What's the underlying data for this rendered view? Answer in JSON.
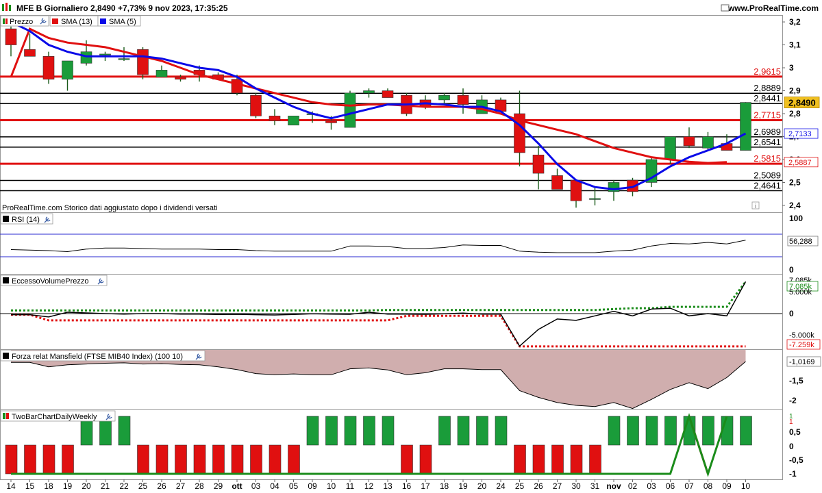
{
  "header": {
    "title": "MFE B Giornaliero 2,8490 +7,73% 9 nov 2023, 17:35:25",
    "site": "www.ProRealTime.com",
    "icon_left": "green-red-bars-icon",
    "icon_right": "window-icon"
  },
  "price_panel": {
    "legend": [
      {
        "label": "Prezzo",
        "color": "#1a8c1a",
        "icon": "candles-icon"
      },
      {
        "label": "SMA (13)",
        "color": "#e01010",
        "icon": "line-icon"
      },
      {
        "label": "SMA (5)",
        "color": "#0a0ae8",
        "icon": "line-icon"
      }
    ],
    "note": "ProRealTime.com  Storico dati aggiustato dopo i dividendi versati",
    "info_icon": "i",
    "y_ticks": [
      "3,2",
      "3,1",
      "3",
      "2,9",
      "2,8",
      "2,7",
      "2,6",
      "2,5",
      "2,4"
    ],
    "y_tick_values": [
      3.2,
      3.1,
      3.0,
      2.9,
      2.8,
      2.7,
      2.6,
      2.5,
      2.4
    ],
    "ylim": [
      2.37,
      3.23
    ],
    "last_price_tag": "2,8490",
    "sma5_tag": "2,7133",
    "sma13_tag": "2,5887",
    "levels": [
      {
        "label": "2,9615",
        "value": 2.9615,
        "color": "#e01010"
      },
      {
        "label": "2,8889",
        "value": 2.8889,
        "color": "#000000"
      },
      {
        "label": "2,8441",
        "value": 2.8441,
        "color": "#000000"
      },
      {
        "label": "2,7715",
        "value": 2.7715,
        "color": "#e01010"
      },
      {
        "label": "2,6989",
        "value": 2.6989,
        "color": "#000000"
      },
      {
        "label": "2,6541",
        "value": 2.6541,
        "color": "#000000"
      },
      {
        "label": "2,5815",
        "value": 2.5815,
        "color": "#e01010"
      },
      {
        "label": "2,5089",
        "value": 2.5089,
        "color": "#000000"
      },
      {
        "label": "2,4641",
        "value": 2.4641,
        "color": "#000000"
      }
    ]
  },
  "rsi_panel": {
    "title": "RSI (14)",
    "y_ticks": [
      "100",
      "0"
    ],
    "value_tag": "56,288"
  },
  "evp_panel": {
    "title": "EccessoVolumePrezzo",
    "y_ticks": [
      "5.000k",
      "0",
      "-5.000k"
    ],
    "top_tag_hidden": "7.085k",
    "tag_green": "7.085k",
    "tag_red": "-7.259k",
    "zero_label": "0"
  },
  "mansfield_panel": {
    "title": "Forza relat Mansfield (FTSE MIB40 Index) (100 10)",
    "y_ticks": [
      "-1,5",
      "-2"
    ],
    "value_tag": "-1,0169"
  },
  "twobar_panel": {
    "title": "TwoBarChartDailyWeekly",
    "y_ticks": [
      "0,5",
      "0",
      "-0,5",
      "-1"
    ],
    "top_tags": [
      "1",
      "1"
    ]
  },
  "x_axis": {
    "labels": [
      "14",
      "15",
      "18",
      "19",
      "20",
      "21",
      "22",
      "25",
      "26",
      "27",
      "28",
      "29",
      "ott",
      "03",
      "04",
      "05",
      "09",
      "10",
      "11",
      "12",
      "13",
      "16",
      "17",
      "18",
      "19",
      "20",
      "24",
      "25",
      "26",
      "27",
      "30",
      "31",
      "nov",
      "02",
      "03",
      "06",
      "07",
      "08",
      "09",
      "10"
    ]
  },
  "chart_data": {
    "type": "candlestick",
    "dates": [
      "14",
      "15",
      "18",
      "19",
      "20",
      "21",
      "22",
      "25",
      "26",
      "27",
      "28",
      "29",
      "ott",
      "03",
      "04",
      "05",
      "09",
      "10",
      "11",
      "12",
      "13",
      "16",
      "17",
      "18",
      "19",
      "20",
      "24",
      "25",
      "26",
      "27",
      "30",
      "31",
      "nov",
      "02",
      "03",
      "06",
      "07",
      "08",
      "09"
    ],
    "candles": [
      {
        "o": 3.17,
        "h": 3.18,
        "l": 3.05,
        "c": 3.1
      },
      {
        "o": 3.08,
        "h": 3.15,
        "l": 3.05,
        "c": 3.05
      },
      {
        "o": 3.05,
        "h": 3.07,
        "l": 2.93,
        "c": 2.95
      },
      {
        "o": 2.95,
        "h": 3.03,
        "l": 2.9,
        "c": 3.03
      },
      {
        "o": 3.02,
        "h": 3.12,
        "l": 3.01,
        "c": 3.07
      },
      {
        "o": 3.06,
        "h": 3.07,
        "l": 3.03,
        "c": 3.06
      },
      {
        "o": 3.04,
        "h": 3.09,
        "l": 3.03,
        "c": 3.04
      },
      {
        "o": 3.08,
        "h": 3.09,
        "l": 2.95,
        "c": 2.97
      },
      {
        "o": 2.96,
        "h": 3.01,
        "l": 2.96,
        "c": 2.99
      },
      {
        "o": 2.96,
        "h": 2.97,
        "l": 2.94,
        "c": 2.95
      },
      {
        "o": 2.99,
        "h": 3.01,
        "l": 2.94,
        "c": 2.97
      },
      {
        "o": 2.97,
        "h": 2.98,
        "l": 2.95,
        "c": 2.95
      },
      {
        "o": 2.95,
        "h": 2.97,
        "l": 2.88,
        "c": 2.89
      },
      {
        "o": 2.88,
        "h": 2.89,
        "l": 2.78,
        "c": 2.79
      },
      {
        "o": 2.79,
        "h": 2.82,
        "l": 2.75,
        "c": 2.77
      },
      {
        "o": 2.75,
        "h": 2.79,
        "l": 2.75,
        "c": 2.79
      },
      {
        "o": 2.8,
        "h": 2.81,
        "l": 2.76,
        "c": 2.8
      },
      {
        "o": 2.77,
        "h": 2.79,
        "l": 2.73,
        "c": 2.76
      },
      {
        "o": 2.74,
        "h": 2.9,
        "l": 2.74,
        "c": 2.89
      },
      {
        "o": 2.89,
        "h": 2.91,
        "l": 2.87,
        "c": 2.9
      },
      {
        "o": 2.9,
        "h": 2.91,
        "l": 2.87,
        "c": 2.87
      },
      {
        "o": 2.88,
        "h": 2.89,
        "l": 2.79,
        "c": 2.8
      },
      {
        "o": 2.86,
        "h": 2.88,
        "l": 2.82,
        "c": 2.83
      },
      {
        "o": 2.86,
        "h": 2.89,
        "l": 2.84,
        "c": 2.88
      },
      {
        "o": 2.88,
        "h": 2.91,
        "l": 2.8,
        "c": 2.84
      },
      {
        "o": 2.8,
        "h": 2.88,
        "l": 2.8,
        "c": 2.86
      },
      {
        "o": 2.86,
        "h": 2.87,
        "l": 2.81,
        "c": 2.81
      },
      {
        "o": 2.8,
        "h": 2.9,
        "l": 2.57,
        "c": 2.63
      },
      {
        "o": 2.62,
        "h": 2.66,
        "l": 2.47,
        "c": 2.54
      },
      {
        "o": 2.53,
        "h": 2.56,
        "l": 2.47,
        "c": 2.47
      },
      {
        "o": 2.51,
        "h": 2.51,
        "l": 2.39,
        "c": 2.42
      },
      {
        "o": 2.43,
        "h": 2.48,
        "l": 2.4,
        "c": 2.43
      },
      {
        "o": 2.46,
        "h": 2.51,
        "l": 2.42,
        "c": 2.5
      },
      {
        "o": 2.51,
        "h": 2.52,
        "l": 2.44,
        "c": 2.46
      },
      {
        "o": 2.5,
        "h": 2.61,
        "l": 2.48,
        "c": 2.6
      },
      {
        "o": 2.6,
        "h": 2.7,
        "l": 2.58,
        "c": 2.7
      },
      {
        "o": 2.7,
        "h": 2.74,
        "l": 2.65,
        "c": 2.66
      },
      {
        "o": 2.65,
        "h": 2.72,
        "l": 2.64,
        "c": 2.7
      },
      {
        "o": 2.67,
        "h": 2.71,
        "l": 2.64,
        "c": 2.64
      },
      {
        "o": 2.64,
        "h": 2.85,
        "l": 2.64,
        "c": 2.849
      }
    ],
    "sma13": [
      2.96,
      3.17,
      3.13,
      3.11,
      3.1,
      3.09,
      3.07,
      3.05,
      3.03,
      3.0,
      2.97,
      2.95,
      2.93,
      2.91,
      2.89,
      2.87,
      2.85,
      2.84,
      2.835,
      2.84,
      2.84,
      2.835,
      2.83,
      2.83,
      2.83,
      2.82,
      2.8,
      2.77,
      2.75,
      2.73,
      2.71,
      2.68,
      2.65,
      2.63,
      2.61,
      2.6,
      2.59,
      2.585,
      2.5887
    ],
    "sma5": [
      3.2,
      3.16,
      3.1,
      3.07,
      3.05,
      3.05,
      3.05,
      3.05,
      3.04,
      3.02,
      3.0,
      2.99,
      2.96,
      2.91,
      2.87,
      2.83,
      2.8,
      2.78,
      2.8,
      2.82,
      2.84,
      2.84,
      2.845,
      2.84,
      2.83,
      2.83,
      2.81,
      2.75,
      2.67,
      2.58,
      2.51,
      2.48,
      2.47,
      2.48,
      2.52,
      2.57,
      2.61,
      2.64,
      2.67,
      2.7133
    ],
    "rsi": [
      38,
      37,
      36,
      34,
      39,
      41,
      41,
      40,
      39,
      39,
      39,
      38,
      38,
      36,
      35,
      35,
      35,
      35,
      45,
      45,
      44,
      40,
      40,
      42,
      47,
      46,
      46,
      35,
      33,
      32,
      32,
      32,
      35,
      37,
      45,
      50,
      49,
      52,
      49,
      56.288
    ],
    "evp_line": [
      -250,
      -250,
      -750,
      300,
      150,
      0,
      -100,
      0,
      0,
      -100,
      -100,
      -200,
      -150,
      -250,
      -300,
      -200,
      -50,
      -100,
      -150,
      300,
      -100,
      -100,
      -150,
      -50,
      100,
      -100,
      -100,
      -7200,
      -3500,
      -1200,
      -1500,
      -500,
      500,
      -500,
      1000,
      1200,
      -500,
      0,
      -500,
      7085
    ],
    "evp_green_dotted": [
      700,
      700,
      700,
      700,
      700,
      700,
      700,
      700,
      700,
      700,
      700,
      700,
      700,
      700,
      700,
      700,
      700,
      700,
      700,
      700,
      800,
      800,
      800,
      800,
      800,
      800,
      800,
      800,
      800,
      800,
      800,
      800,
      1000,
      1200,
      1200,
      1500,
      1500,
      1500,
      1500,
      7085
    ],
    "evp_red_dotted": [
      -250,
      -250,
      -1500,
      -1500,
      -1500,
      -1500,
      -1500,
      -1500,
      -1500,
      -1500,
      -1500,
      -1500,
      -1500,
      -1500,
      -1500,
      -1500,
      -1500,
      -1500,
      -1500,
      -1500,
      -1500,
      -500,
      -500,
      -500,
      -500,
      -500,
      -500,
      -7259,
      -7259,
      -7259,
      -7259,
      -7259,
      -7259,
      -7259,
      -7259,
      -7259,
      -7259,
      -7259,
      -7259,
      -7259
    ],
    "mansfield": [
      -1.04,
      -1.04,
      -1.15,
      -1.1,
      -1.08,
      -1.06,
      -1.05,
      -1.08,
      -1.07,
      -1.09,
      -1.1,
      -1.15,
      -1.22,
      -1.32,
      -1.35,
      -1.33,
      -1.35,
      -1.35,
      -1.2,
      -1.18,
      -1.23,
      -1.35,
      -1.3,
      -1.2,
      -1.2,
      -1.22,
      -1.22,
      -1.75,
      -1.92,
      -2.05,
      -2.12,
      -2.15,
      -2.05,
      -2.2,
      -1.97,
      -1.72,
      -1.55,
      -1.7,
      -1.42,
      -1.0169
    ],
    "twobar_bars": [
      -1,
      -1,
      -1,
      -1,
      1,
      1,
      1,
      -1,
      -1,
      -1,
      -1,
      -1,
      -1,
      -1,
      -1,
      -1,
      1,
      1,
      1,
      1,
      1,
      -1,
      -1,
      1,
      1,
      1,
      1,
      -1,
      -1,
      -1,
      -1,
      -1,
      1,
      1,
      1,
      1,
      1,
      1,
      1,
      1
    ],
    "twobar_line": [
      -1,
      -1,
      -1,
      -1,
      -1,
      -1,
      -1,
      -1,
      -1,
      -1,
      -1,
      -1,
      -1,
      -1,
      -1,
      -1,
      -1,
      -1,
      -1,
      -1,
      -1,
      -1,
      -1,
      -1,
      -1,
      -1,
      -1,
      -1,
      -1,
      -1,
      -1,
      -1,
      -1,
      -1,
      -1,
      -1,
      1,
      -1,
      1
    ]
  }
}
